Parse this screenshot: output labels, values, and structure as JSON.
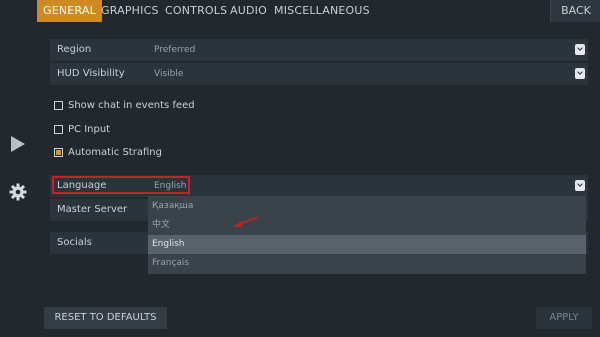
{
  "tabs": [
    {
      "label": "GENERAL",
      "active": true
    },
    {
      "label": "GRAPHICS",
      "active": false
    },
    {
      "label": "CONTROLS",
      "active": false
    },
    {
      "label": "AUDIO",
      "active": false
    },
    {
      "label": "MISCELLANEOUS",
      "active": false
    }
  ],
  "back_label": "BACK",
  "sidebar": {
    "icons": [
      "play-icon",
      "gear-icon"
    ]
  },
  "settings": {
    "region": {
      "label": "Region",
      "value": "Preferred"
    },
    "hud": {
      "label": "HUD Visibility",
      "value": "Visible"
    },
    "show_chat": {
      "label": "Show chat in events feed",
      "checked": false
    },
    "pc_input": {
      "label": "PC Input",
      "checked": false
    },
    "auto_strafing": {
      "label": "Automatic Strafing",
      "checked": true
    },
    "language": {
      "label": "Language",
      "value": "English"
    },
    "master_server": {
      "label": "Master Server"
    },
    "socials": {
      "label": "Socials"
    }
  },
  "language_options": [
    {
      "label": "Қазақша",
      "selected": false
    },
    {
      "label": "中文",
      "selected": false
    },
    {
      "label": "English",
      "selected": true
    },
    {
      "label": "Français",
      "selected": false
    }
  ],
  "buttons": {
    "reset": "RESET TO DEFAULTS",
    "apply": "APPLY"
  },
  "colors": {
    "accent": "#cf8a22",
    "highlight_border": "#c8202a",
    "arrow": "#c8202a"
  }
}
